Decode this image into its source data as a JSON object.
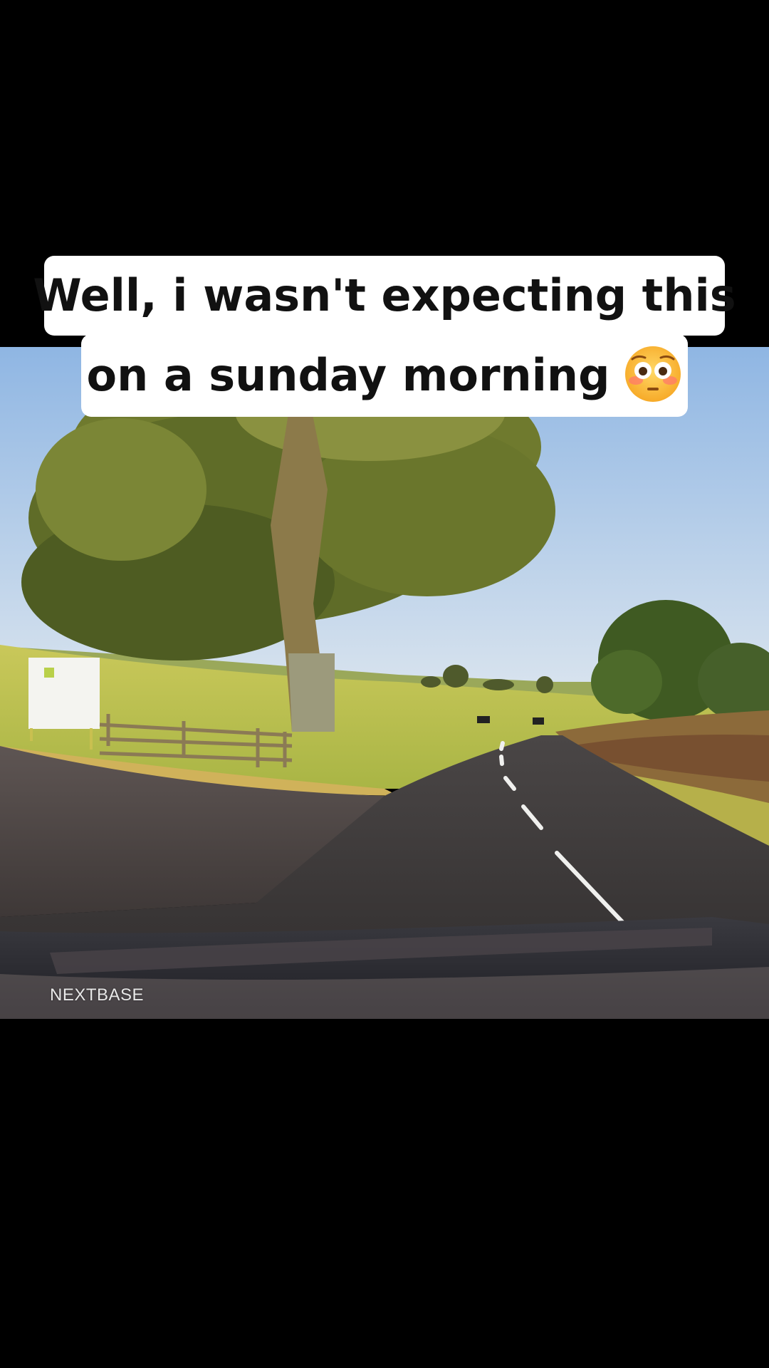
{
  "caption": {
    "line1": "Well, i wasn't expecting this",
    "line2": "on a sunday morning",
    "emoji_icon": "flushed-face-emoji"
  },
  "video": {
    "watermark": "NEXTBASE"
  },
  "colors": {
    "background": "#000000",
    "caption_bg": "#ffffff",
    "caption_text": "#111111",
    "sky": "#a9c6e6",
    "grass": "#b9c150",
    "road": "#3a3838"
  }
}
